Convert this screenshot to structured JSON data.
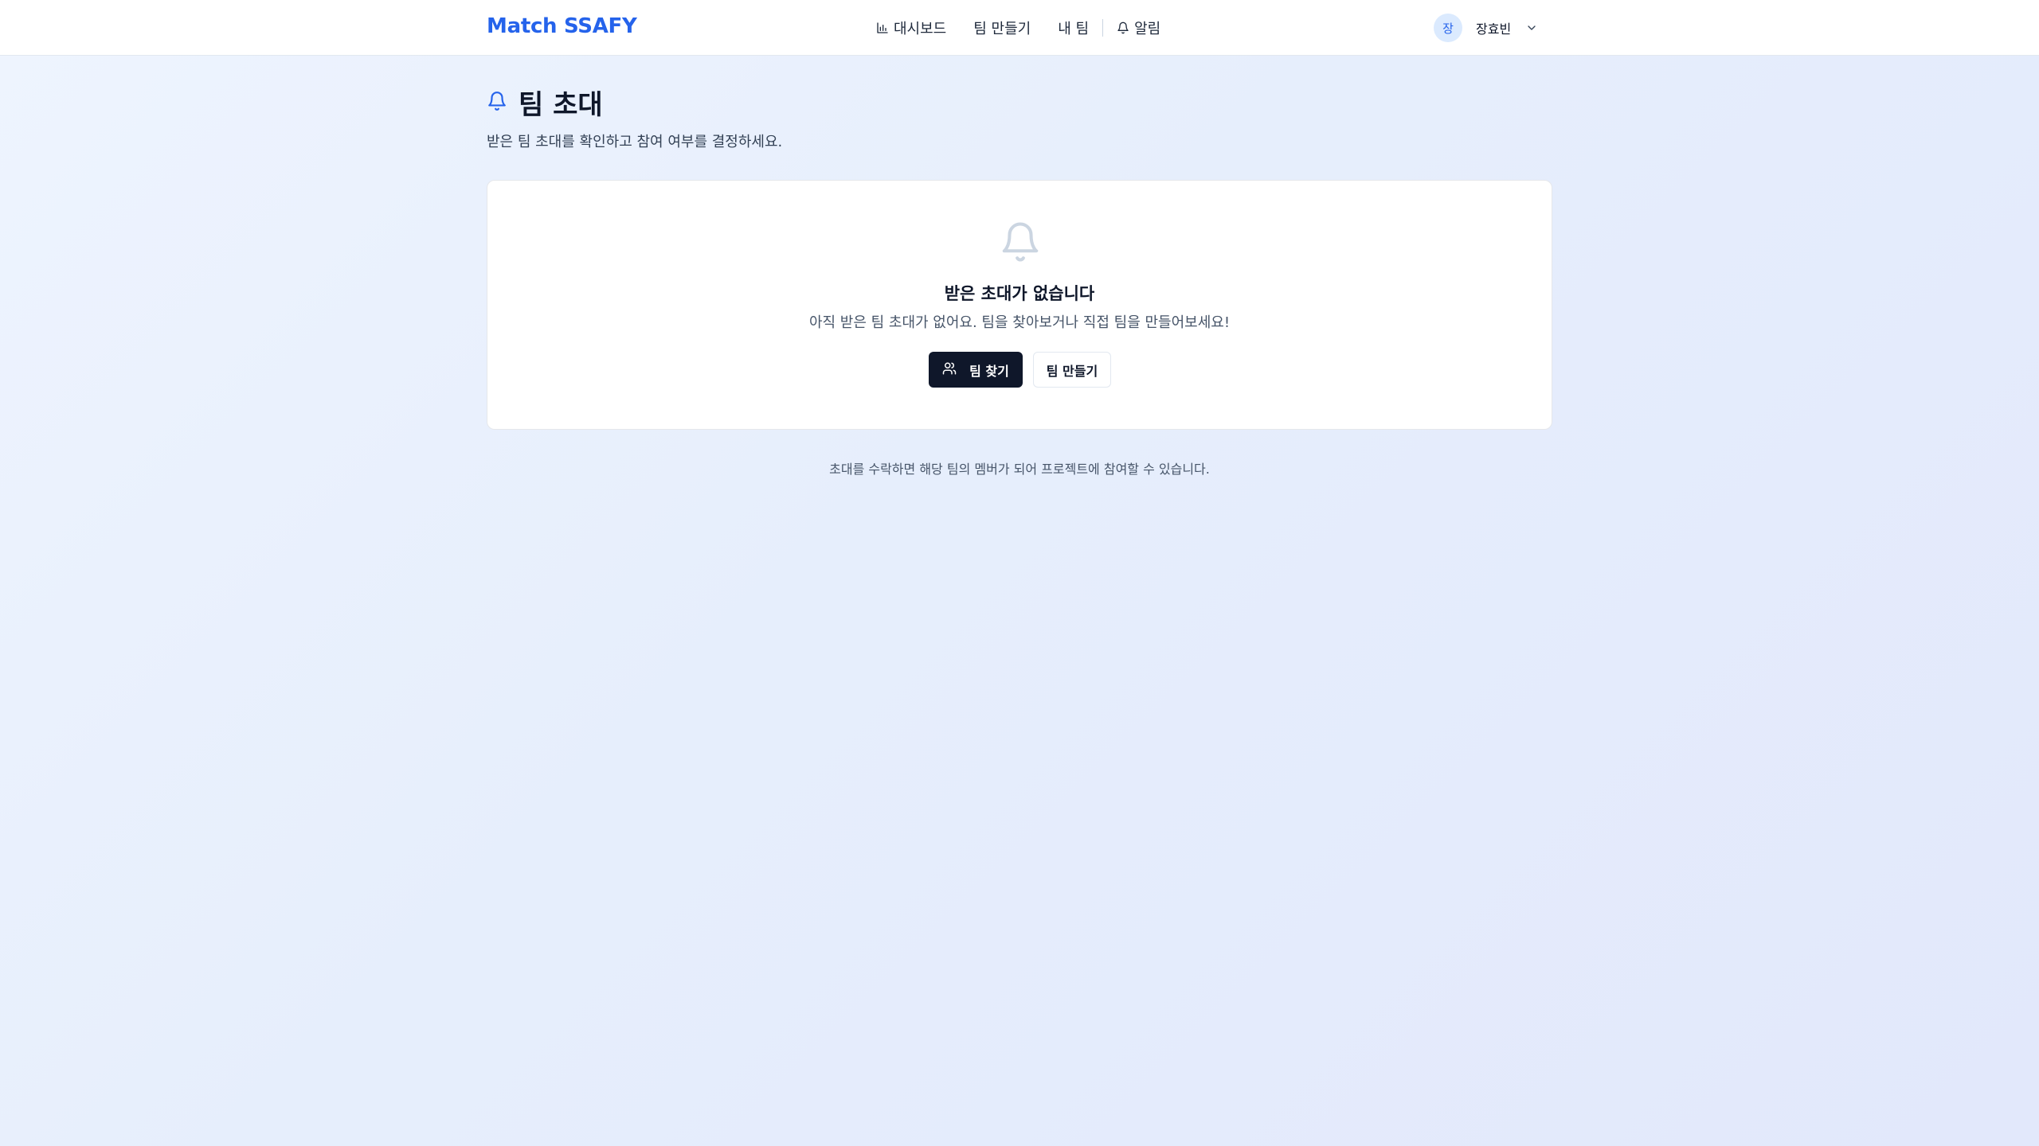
{
  "header": {
    "brand": "Match SSAFY",
    "nav": [
      {
        "label": "대시보드",
        "icon": "bar-chart-icon"
      },
      {
        "label": "팀 만들기"
      },
      {
        "label": "내 팀"
      },
      {
        "label": "알림",
        "icon": "bell-icon"
      }
    ],
    "user": {
      "avatar_initial": "장",
      "name": "장효빈",
      "menu_icon": "chevron-down-icon"
    }
  },
  "page": {
    "title": "팀 초대",
    "title_icon": "bell-icon",
    "subtitle": "받은 팀 초대를 확인하고 참여 여부를 결정하세요."
  },
  "empty_state": {
    "icon": "bell-icon",
    "title": "받은 초대가 없습니다",
    "description": "아직 받은 팀 초대가 없어요. 팀을 찾아보거나 직접 팀을 만들어보세요!",
    "primary_button": {
      "label": "팀 찾기",
      "icon": "users-icon"
    },
    "secondary_button": {
      "label": "팀 만들기"
    }
  },
  "footer_note": "초대를 수락하면 해당 팀의 멤버가 되어 프로젝트에 참여할 수 있습니다.",
  "colors": {
    "brand": "#2563eb",
    "primary_button": "#0f172a",
    "background": "#e8effc"
  }
}
